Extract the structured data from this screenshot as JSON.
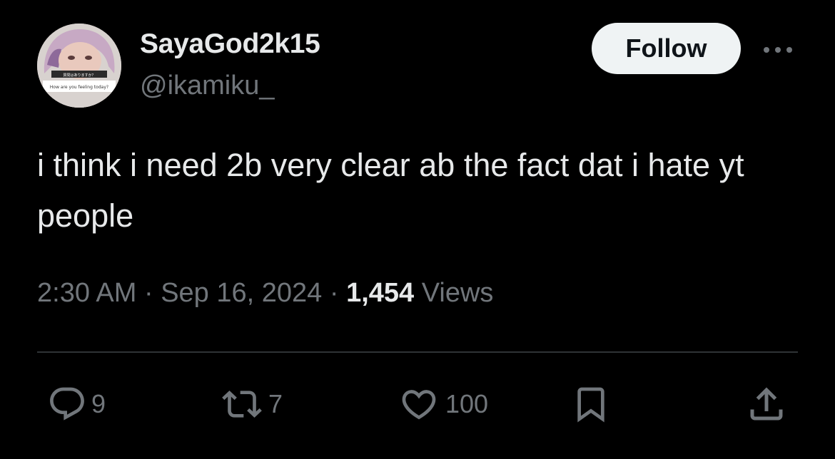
{
  "tweet": {
    "author": {
      "display_name": "SayaGod2k15",
      "handle": "@ikamiku_",
      "avatar_caption": "How are you feeling today?",
      "avatar_caption_top": "質問はありますか？"
    },
    "follow_label": "Follow",
    "text": "i think i need 2b very clear ab the fact dat i hate yt people",
    "time": "2:30 AM",
    "date": "Sep 16, 2024",
    "separator": "·",
    "views_count": "1,454",
    "views_label": "Views",
    "stats": {
      "replies": "9",
      "reposts": "7",
      "likes": "100"
    }
  },
  "icons": {
    "more": "ellipsis-icon",
    "reply": "reply-icon",
    "repost": "repost-icon",
    "like": "heart-icon",
    "bookmark": "bookmark-icon",
    "share": "share-icon"
  },
  "colors": {
    "background": "#000000",
    "primary_text": "#e7e9ea",
    "secondary_text": "#71767b",
    "divider": "#2f3336",
    "follow_bg": "#eff3f4"
  }
}
